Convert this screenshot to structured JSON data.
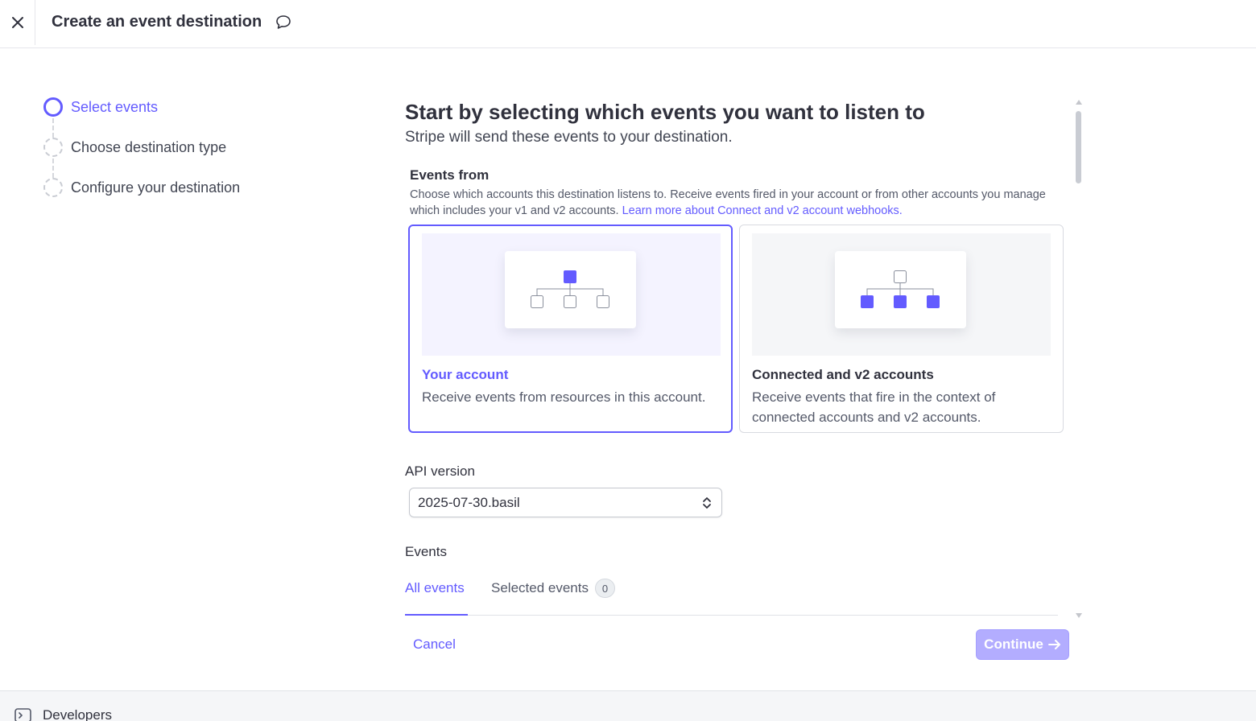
{
  "header": {
    "title": "Create an event destination",
    "close_icon": "close-icon",
    "feedback_icon": "chat-bubble-icon"
  },
  "steps": [
    {
      "label": "Select events",
      "state": "active"
    },
    {
      "label": "Choose destination type",
      "state": "pending"
    },
    {
      "label": "Configure your destination",
      "state": "pending"
    }
  ],
  "main": {
    "title": "Start by selecting which events you want to listen to",
    "subtitle": "Stripe will send these events to your destination.",
    "events_from": {
      "label": "Events from",
      "description": "Choose which accounts this destination listens to. Receive events fired in your account or from other accounts you manage which includes your v1 and v2 accounts. ",
      "link": "Learn more about Connect and v2 account webhooks."
    },
    "cards": [
      {
        "title": "Your account",
        "description": "Receive events from resources in this account.",
        "selected": true
      },
      {
        "title": "Connected and v2 accounts",
        "description": "Receive events that fire in the context of connected accounts and v2 accounts.",
        "selected": false
      }
    ],
    "api_version": {
      "label": "API version",
      "value": "2025-07-30.basil"
    },
    "events": {
      "label": "Events",
      "tabs": [
        {
          "label": "All events",
          "active": true
        },
        {
          "label": "Selected events",
          "badge": "0",
          "active": false
        }
      ]
    }
  },
  "actions": {
    "cancel": "Cancel",
    "continue": "Continue"
  },
  "footer": {
    "label": "Developers",
    "icon": "terminal-icon"
  },
  "colors": {
    "accent": "#635bff",
    "accent_disabled": "#b3adff",
    "text": "#30313d",
    "muted": "#545969"
  }
}
